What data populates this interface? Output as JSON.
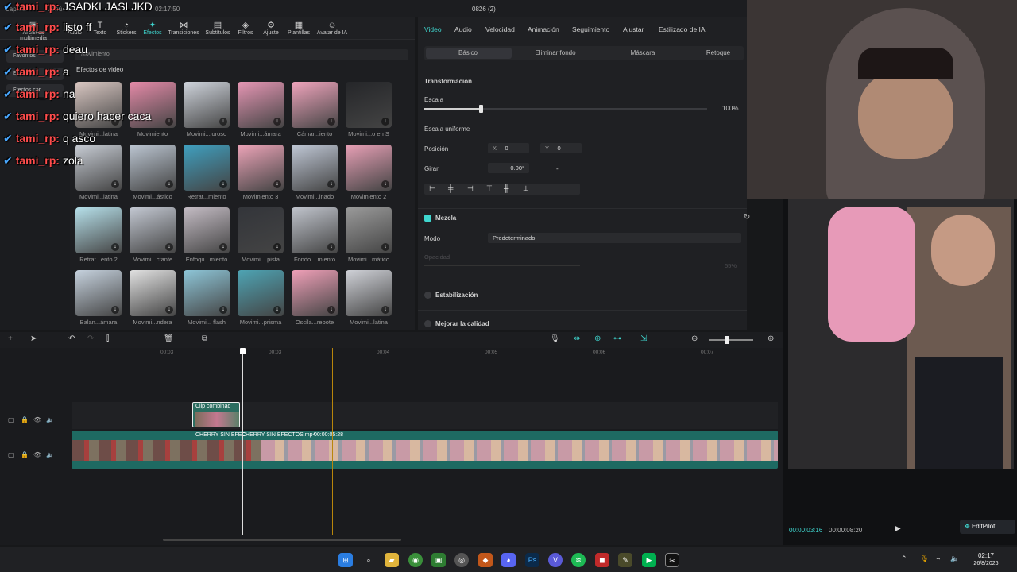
{
  "window": {
    "app_title": "CapCut",
    "menu": "Menú",
    "project_name": "0826 (2)",
    "clock_top": "02:17:50"
  },
  "top_nav": {
    "items": [
      {
        "label": "Archivos multimedia",
        "icon": "media-icon"
      },
      {
        "label": "Audio",
        "icon": "audio-icon"
      },
      {
        "label": "Texto",
        "icon": "text-icon"
      },
      {
        "label": "Stickers",
        "icon": "sticker-icon"
      },
      {
        "label": "Efectos",
        "icon": "effects-icon"
      },
      {
        "label": "Transiciones",
        "icon": "transition-icon"
      },
      {
        "label": "Subtítulos",
        "icon": "subtitle-icon"
      },
      {
        "label": "Filtros",
        "icon": "filter-icon"
      },
      {
        "label": "Ajuste",
        "icon": "adjust-icon"
      },
      {
        "label": "Plantillas",
        "icon": "template-icon"
      },
      {
        "label": "Avatar de IA",
        "icon": "avatar-icon"
      }
    ]
  },
  "left_nav": {
    "items": [
      "Favoritos",
      "Efectos...",
      "Efectos cor..."
    ]
  },
  "effects_panel": {
    "search_value": "Movimiento",
    "section_title": "Efectos de video",
    "items": [
      "Movimi...latina",
      "Movimiento",
      "Movimi...loroso",
      "Movimi...ámara",
      "Cámar...iento",
      "Movimi...o en S",
      "Movimi...latina",
      "Movimi...ástico",
      "Retrat...miento",
      "Movimiento 3",
      "Movimi...inado",
      "Movimiento 2",
      "Retrat...ento 2",
      "Movimi...ctante",
      "Enfoqu...miento",
      "Movimi... pista",
      "Fondo ...miento",
      "Movimi...mático",
      "Balan...ámara",
      "Movimi...ndera",
      "Movimi... flash",
      "Movimi...prisma",
      "Oscila...rebote",
      "Movimi...latina"
    ]
  },
  "chat": [
    {
      "user": "tami_rp",
      "msg": "JSADKLJASLJKD"
    },
    {
      "user": "tami_rp",
      "msg": "listo ff"
    },
    {
      "user": "tami_rp",
      "msg": "deau"
    },
    {
      "user": "tami_rp",
      "msg": "a"
    },
    {
      "user": "tami_rp",
      "msg": "na"
    },
    {
      "user": "tami_rp",
      "msg": "quiero hacer caca"
    },
    {
      "user": "tami_rp",
      "msg": "q asco"
    },
    {
      "user": "tami_rp",
      "msg": "zola"
    }
  ],
  "props": {
    "tabs": [
      "Video",
      "Audio",
      "Velocidad",
      "Animación",
      "Seguimiento",
      "Ajustar",
      "Estilizado de IA"
    ],
    "subtabs": [
      "Básico",
      "Eliminar fondo",
      "Máscara",
      "Retoque"
    ],
    "transform_title": "Transformación",
    "scale_label": "Escala",
    "scale_value": "100%",
    "scale_fraction": 0.2,
    "uniform_label": "Escala uniforme",
    "position_label": "Posición",
    "pos_x_label": "X",
    "pos_x": "0",
    "pos_y_label": "Y",
    "pos_y": "0",
    "rotate_label": "Girar",
    "rotate_value": "0.00°",
    "rotate_extra": "-",
    "blend_title": "Mezcla",
    "mode_label": "Modo",
    "mode_value": "Predeterminado",
    "opacity_label": "Opacidad",
    "opacity_value": "55%",
    "stabilization": "Estabilización",
    "enhance": "Mejorar la calidad"
  },
  "timeline": {
    "ruler": [
      "00:03",
      "00:03",
      "00:04",
      "00:05",
      "00:06",
      "00:07"
    ],
    "clip_combined": "Clip combinad",
    "main_clip_a": "CHERRY SIN EFEC",
    "main_clip_b": "CHERRY SIN EFECTOS.mp4",
    "main_clip_dur": "00:00:05:28"
  },
  "preview": {
    "current": "00:00:03:16",
    "total": "00:00:08:20",
    "editpilot": "EditPilot"
  },
  "taskbar": {
    "time": "02:17",
    "date": "26/8/2026"
  }
}
